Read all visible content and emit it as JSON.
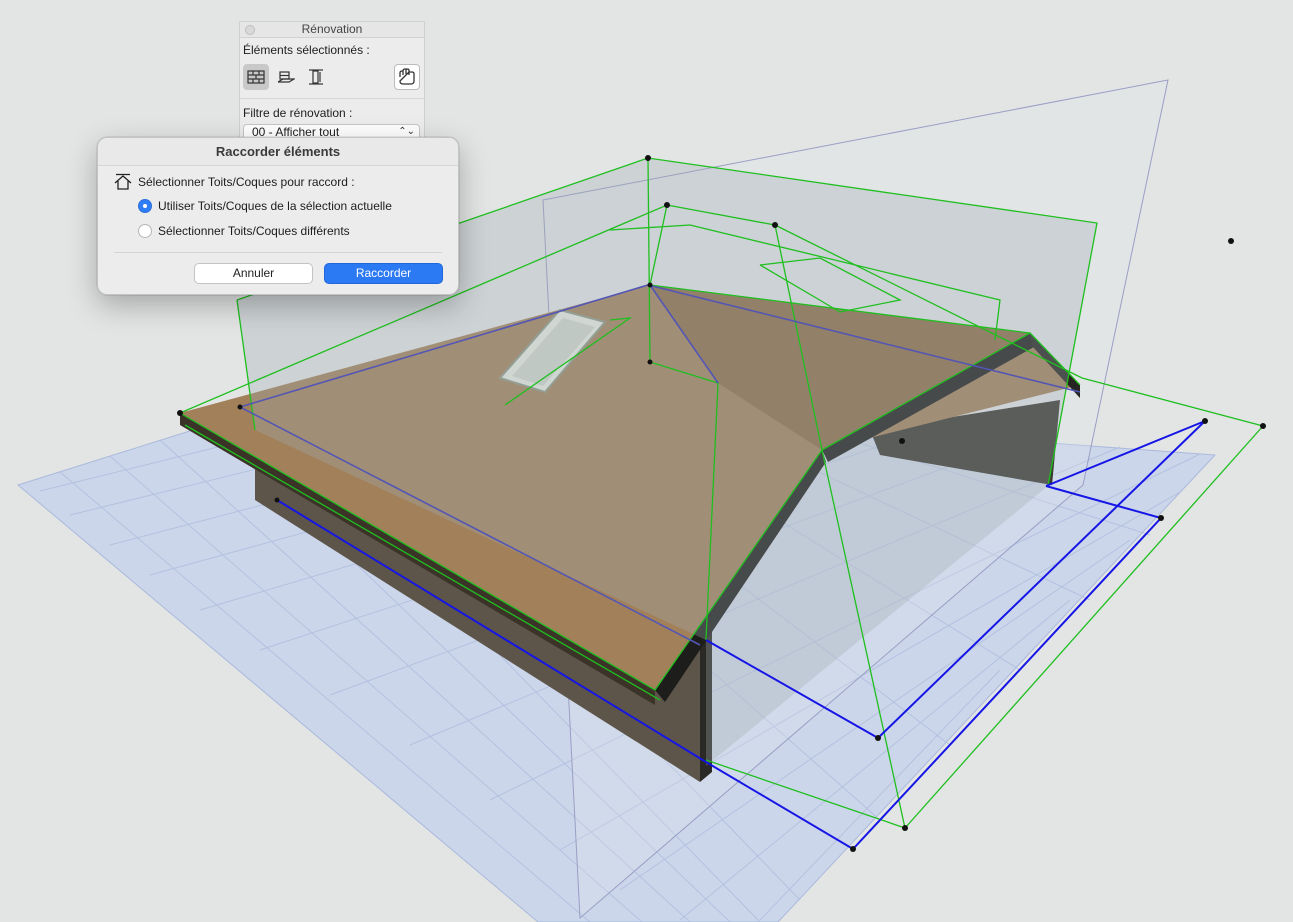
{
  "renovation_palette": {
    "title": "Rénovation",
    "selected_elements_label": "Éléments sélectionnés :",
    "tools": [
      {
        "icon": "wall-icon",
        "selected": true
      },
      {
        "icon": "slab-icon",
        "selected": false
      },
      {
        "icon": "column-icon",
        "selected": false
      }
    ],
    "settings_icon": "hand-settings-icon",
    "filter_label": "Filtre de rénovation :",
    "filter_value": "00 - Afficher tout"
  },
  "dialog": {
    "title": "Raccorder éléments",
    "prompt": "Sélectionner Toits/Coques pour raccord :",
    "prompt_icon": "roof-icon",
    "options": [
      {
        "label": "Utiliser Toits/Coques de la sélection actuelle",
        "checked": true
      },
      {
        "label": "Sélectionner Toits/Coques différents",
        "checked": false
      }
    ],
    "cancel_label": "Annuler",
    "confirm_label": "Raccorder"
  },
  "colors": {
    "background": "#e3e5e5",
    "grid": "#a9b9dc",
    "roof": "#a2805a",
    "wall": "#3d3a33",
    "selection_outline": "#1fbf1f",
    "plan_outline": "#1515e6",
    "accent_button": "#2b7af4"
  }
}
